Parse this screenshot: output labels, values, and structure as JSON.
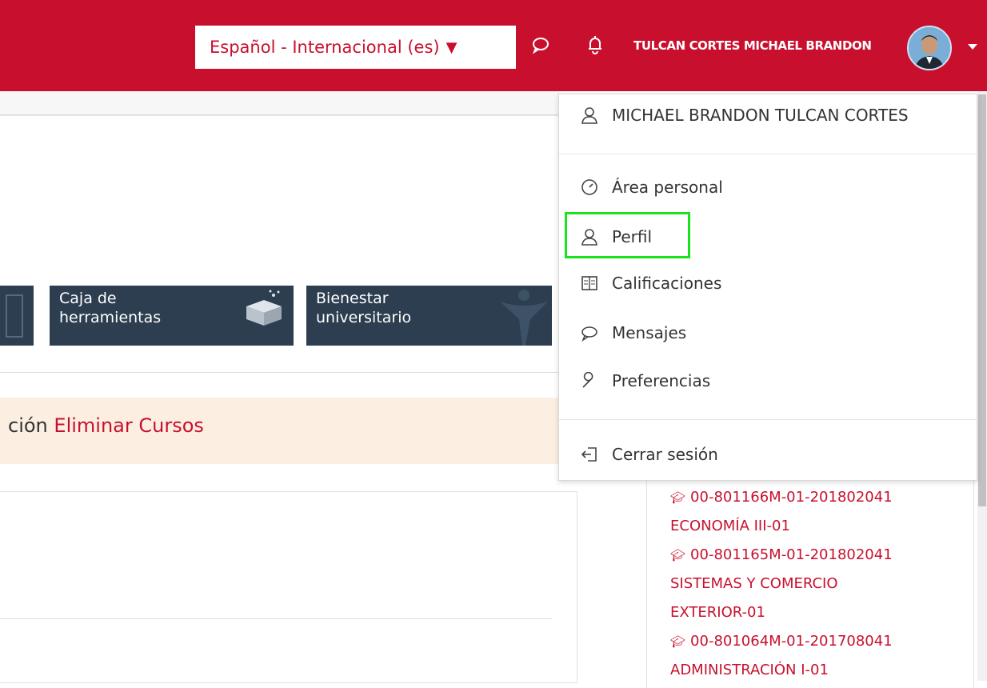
{
  "header": {
    "language": "Español - Internacional (es)",
    "language_caret": "▼",
    "user_name": "TULCAN CORTES MICHAEL BRANDON",
    "icons": [
      "message-icon",
      "bell-icon",
      "avatar",
      "chevron-down-icon"
    ]
  },
  "tiles": [
    {
      "label_line1": "Caja de",
      "label_line2": "herramientas",
      "icon": "toolbox-icon"
    },
    {
      "label_line1": "Bienestar",
      "label_line2": "universitario",
      "icon": "person-icon"
    }
  ],
  "notice": {
    "prefix": "ción",
    "link": "Eliminar Cursos"
  },
  "user_menu": {
    "full_name": "MICHAEL BRANDON TULCAN CORTES",
    "items": [
      {
        "label": "Área personal",
        "icon": "dashboard-icon"
      },
      {
        "label": "Perfil",
        "icon": "user-icon"
      },
      {
        "label": "Calificaciones",
        "icon": "grades-icon"
      },
      {
        "label": "Mensajes",
        "icon": "message-icon"
      },
      {
        "label": "Preferencias",
        "icon": "wrench-icon"
      }
    ],
    "logout": "Cerrar sesión"
  },
  "courses": [
    {
      "line1": "00-801166M-01-201802041",
      "line2": "ECONOMÍA III-01"
    },
    {
      "line1": "00-801165M-01-201802041",
      "line2": "SISTEMAS Y COMERCIO",
      "line3": "EXTERIOR-01"
    },
    {
      "line1": "00-801064M-01-201708041",
      "line2": "ADMINISTRACIÓN I-01"
    }
  ],
  "colors": {
    "brand_red": "#c8102e",
    "tile_bg": "#2d3e50",
    "notice_bg": "#fcefe1",
    "highlight": "#19e31a"
  }
}
